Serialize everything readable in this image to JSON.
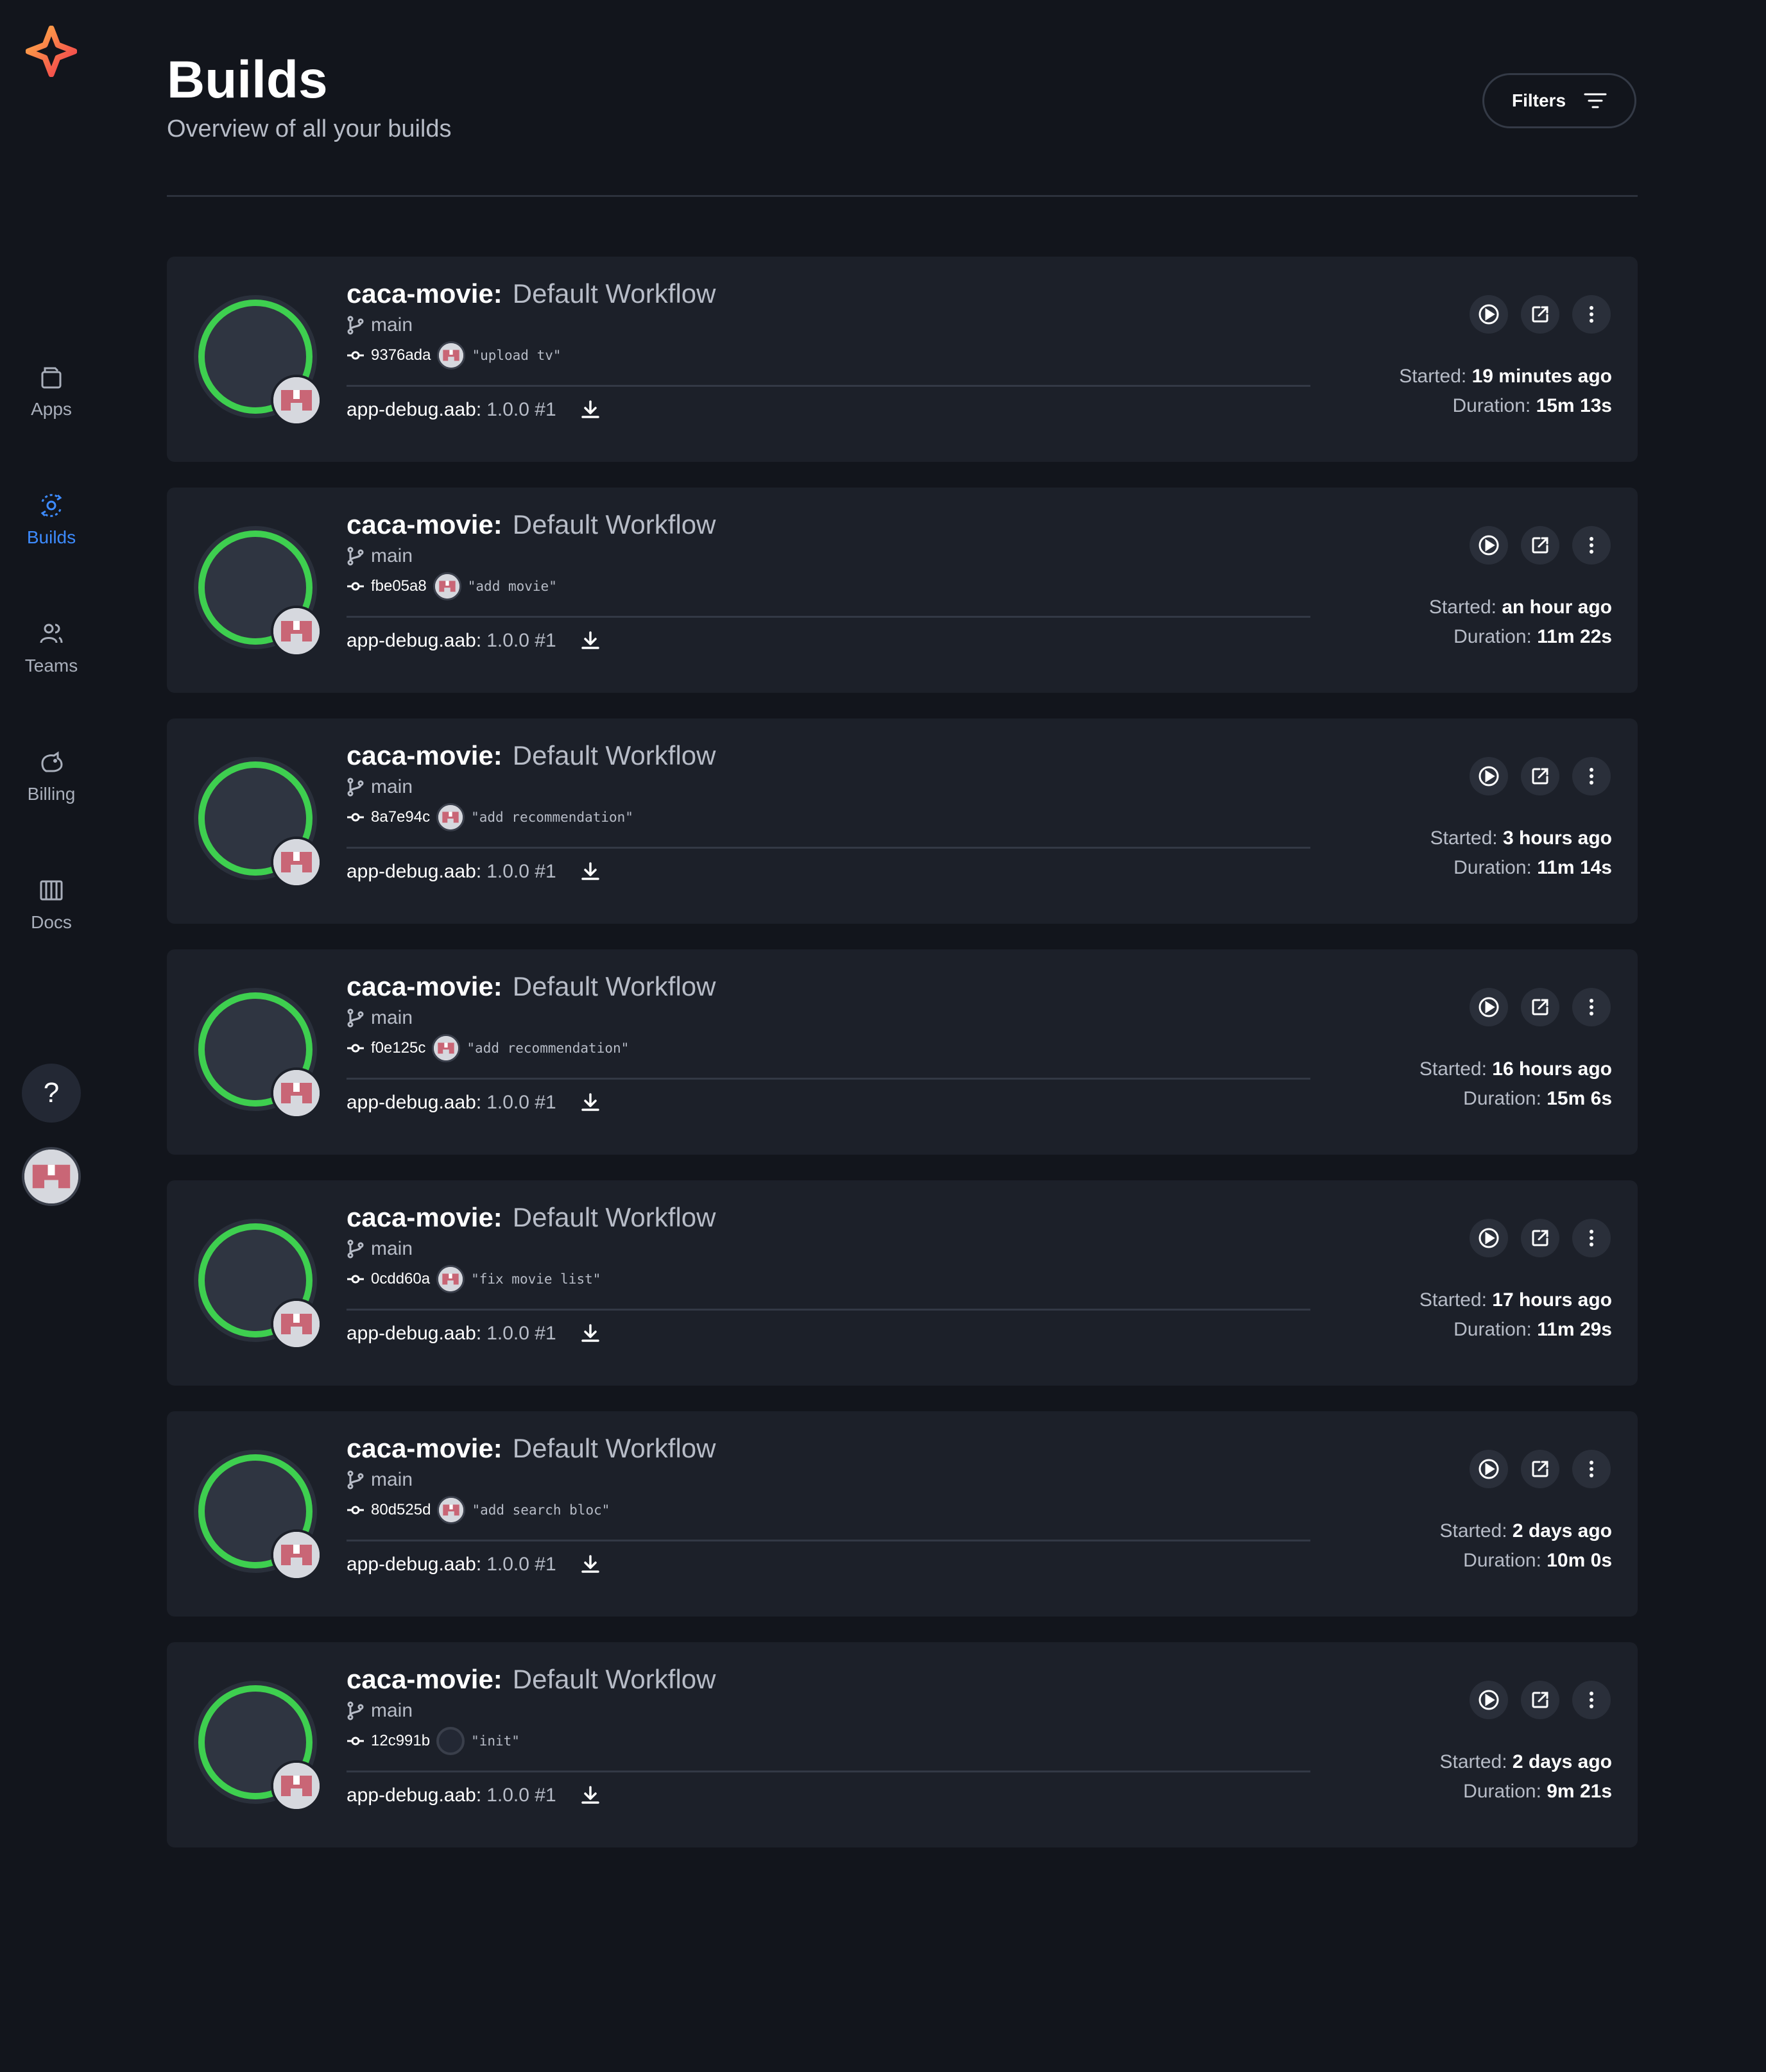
{
  "sidebar": {
    "items": [
      {
        "label": "Apps",
        "icon": "apps-icon"
      },
      {
        "label": "Builds",
        "icon": "builds-icon",
        "active": true
      },
      {
        "label": "Teams",
        "icon": "teams-icon"
      },
      {
        "label": "Billing",
        "icon": "billing-icon"
      },
      {
        "label": "Docs",
        "icon": "docs-icon"
      }
    ],
    "help_label": "?"
  },
  "header": {
    "title": "Builds",
    "subtitle": "Overview of all your builds",
    "filters_label": "Filters"
  },
  "labels": {
    "started": "Started:",
    "duration": "Duration:"
  },
  "colors": {
    "accent": "#3d8bff",
    "success": "#3ecf4f",
    "background": "#12151c",
    "card": "#1c2029"
  },
  "builds": [
    {
      "app": "caca-movie:",
      "workflow": "Default Workflow",
      "branch": "main",
      "commit": "9376ada",
      "message": "\"upload tv\"",
      "artifact": "app-debug.aab:",
      "version": "1.0.0 #1",
      "started": "19 minutes ago",
      "duration": "15m 13s"
    },
    {
      "app": "caca-movie:",
      "workflow": "Default Workflow",
      "branch": "main",
      "commit": "fbe05a8",
      "message": "\"add movie\"",
      "artifact": "app-debug.aab:",
      "version": "1.0.0 #1",
      "started": "an hour ago",
      "duration": "11m 22s"
    },
    {
      "app": "caca-movie:",
      "workflow": "Default Workflow",
      "branch": "main",
      "commit": "8a7e94c",
      "message": "\"add recommendation\"",
      "artifact": "app-debug.aab:",
      "version": "1.0.0 #1",
      "started": "3 hours ago",
      "duration": "11m 14s"
    },
    {
      "app": "caca-movie:",
      "workflow": "Default Workflow",
      "branch": "main",
      "commit": "f0e125c",
      "message": "\"add recommendation\"",
      "artifact": "app-debug.aab:",
      "version": "1.0.0 #1",
      "started": "16 hours ago",
      "duration": "15m 6s"
    },
    {
      "app": "caca-movie:",
      "workflow": "Default Workflow",
      "branch": "main",
      "commit": "0cdd60a",
      "message": "\"fix movie list\"",
      "artifact": "app-debug.aab:",
      "version": "1.0.0 #1",
      "started": "17 hours ago",
      "duration": "11m 29s"
    },
    {
      "app": "caca-movie:",
      "workflow": "Default Workflow",
      "branch": "main",
      "commit": "80d525d",
      "message": "\"add search bloc\"",
      "artifact": "app-debug.aab:",
      "version": "1.0.0 #1",
      "started": "2 days ago",
      "duration": "10m 0s"
    },
    {
      "app": "caca-movie:",
      "workflow": "Default Workflow",
      "branch": "main",
      "commit": "12c991b",
      "message": "\"init\"",
      "artifact": "app-debug.aab:",
      "version": "1.0.0 #1",
      "started": "2 days ago",
      "duration": "9m 21s",
      "no_avatar": true
    }
  ]
}
